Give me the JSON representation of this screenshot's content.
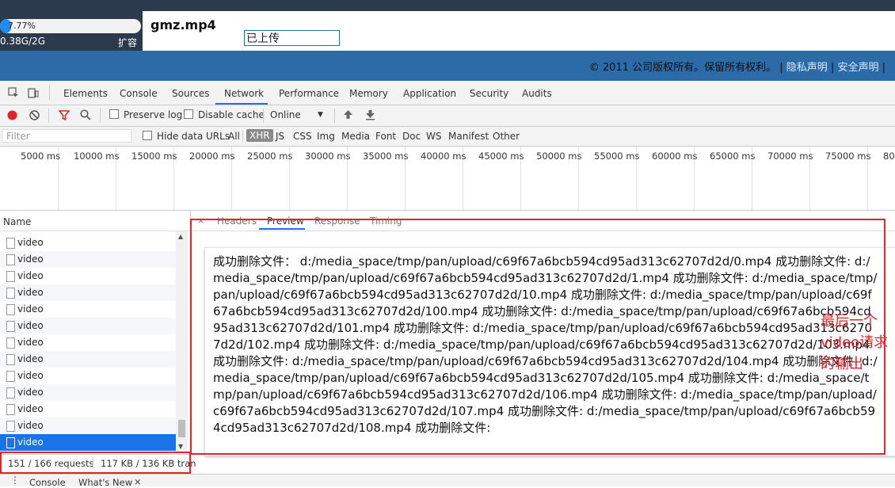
{
  "webpage": {
    "storage_percent": "7.77%",
    "storage_progress": 0.0777,
    "storage_quota": "0.38G/2G",
    "expand_label": "扩容",
    "file_name": "gmz.mp4",
    "upload_status": "已上传",
    "footer": {
      "copyright": "© 2011 公司版权所有。保留所有权利。",
      "separator": "|",
      "privacy": "隐私声明",
      "security": "安全声明"
    }
  },
  "devtools": {
    "tabs": [
      "Elements",
      "Console",
      "Sources",
      "Network",
      "Performance",
      "Memory",
      "Application",
      "Security",
      "Audits"
    ],
    "active_tab": "Network",
    "toolbar": {
      "preserve_log": "Preserve log",
      "disable_cache": "Disable cache",
      "throttle": "Online"
    },
    "filter": {
      "placeholder": "Filter",
      "hide_data_urls": "Hide data URLs",
      "types": [
        "All",
        "XHR",
        "JS",
        "CSS",
        "Img",
        "Media",
        "Font",
        "Doc",
        "WS",
        "Manifest",
        "Other"
      ],
      "selected_type": "XHR"
    },
    "timeline_ticks": [
      "5000 ms",
      "10000 ms",
      "15000 ms",
      "20000 ms",
      "25000 ms",
      "30000 ms",
      "35000 ms",
      "40000 ms",
      "45000 ms",
      "50000 ms",
      "55000 ms",
      "60000 ms",
      "65000 ms",
      "70000 ms",
      "75000 ms",
      "80"
    ],
    "list": {
      "header": "Name",
      "rows": [
        "video",
        "video",
        "video",
        "video",
        "video",
        "video",
        "video",
        "video",
        "video",
        "video",
        "video",
        "video",
        "video"
      ],
      "selected_index": 12
    },
    "status": {
      "requests": "151 / 166 requests",
      "transferred": "117 KB / 136 KB tran"
    },
    "detail_tabs": [
      "Headers",
      "Preview",
      "Response",
      "Timing"
    ],
    "active_detail_tab": "Preview",
    "preview_text": "成功删除文件： d:/media_space/tmp/pan/upload/c69f67a6bcb594cd95ad313c62707d2d/0.mp4 成功删除文件: d:/media_space/tmp/pan/upload/c69f67a6bcb594cd95ad313c62707d2d/1.mp4 成功删除文件: d:/media_space/tmp/pan/upload/c69f67a6bcb594cd95ad313c62707d2d/10.mp4 成功删除文件: d:/media_space/tmp/pan/upload/c69f67a6bcb594cd95ad313c62707d2d/100.mp4 成功删除文件: d:/media_space/tmp/pan/upload/c69f67a6bcb594cd95ad313c62707d2d/101.mp4 成功删除文件: d:/media_space/tmp/pan/upload/c69f67a6bcb594cd95ad313c62707d2d/102.mp4 成功删除文件: d:/media_space/tmp/pan/upload/c69f67a6bcb594cd95ad313c62707d2d/103.mp4 成功删除文件: d:/media_space/tmp/pan/upload/c69f67a6bcb594cd95ad313c62707d2d/104.mp4 成功删除文件: d:/media_space/tmp/pan/upload/c69f67a6bcb594cd95ad313c62707d2d/105.mp4 成功删除文件: d:/media_space/tmp/pan/upload/c69f67a6bcb594cd95ad313c62707d2d/106.mp4 成功删除文件: d:/media_space/tmp/pan/upload/c69f67a6bcb594cd95ad313c62707d2d/107.mp4 成功删除文件: d:/media_space/tmp/pan/upload/c69f67a6bcb594cd95ad313c62707d2d/108.mp4 成功删除文件:",
    "drawer_tabs": [
      "Console",
      "What's New"
    ]
  },
  "annotation": "最后一个video请求的输出",
  "colors": {
    "accent": "#1a73e8",
    "annotation_red": "#e0242b",
    "page_header": "#2b3a4c",
    "page_footer": "#2d6aa8"
  }
}
